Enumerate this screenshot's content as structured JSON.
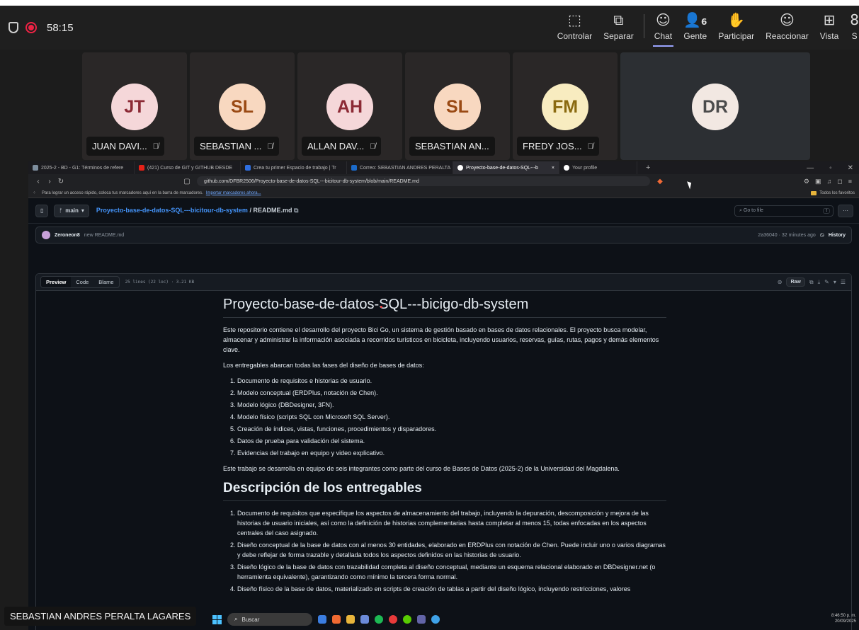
{
  "meeting": {
    "timer": "58:15",
    "tools": [
      {
        "label": "Controlar",
        "icon": "control-icon"
      },
      {
        "label": "Separar",
        "icon": "popout-icon"
      },
      {
        "label": "Chat",
        "icon": "chat-icon"
      },
      {
        "label": "Gente",
        "icon": "people-icon",
        "count": "6"
      },
      {
        "label": "Participar",
        "icon": "raise-hand-icon"
      },
      {
        "label": "Reaccionar",
        "icon": "react-icon"
      },
      {
        "label": "Vista",
        "icon": "view-icon"
      },
      {
        "label": "S",
        "icon": "share-icon"
      }
    ],
    "participants": [
      {
        "initials": "JT",
        "name": "JUAN DAVI...",
        "bg": "#f5d7d9",
        "fg": "#8c2a35"
      },
      {
        "initials": "SL",
        "name": "SEBASTIAN ...",
        "bg": "#f8d8c0",
        "fg": "#9a4a14"
      },
      {
        "initials": "AH",
        "name": "ALLAN DAV...",
        "bg": "#f5d7d9",
        "fg": "#8c2a35"
      },
      {
        "initials": "SL",
        "name": "SEBASTIAN AN...",
        "bg": "#f8d8c0",
        "fg": "#9a4a14"
      },
      {
        "initials": "FM",
        "name": "FREDY JOS...",
        "bg": "#f8ecc0",
        "fg": "#8a6a10"
      },
      {
        "initials": "DR",
        "name": "",
        "bg": "#f2e8e2",
        "fg": "#4b4b4b"
      }
    ],
    "presenter": "SEBASTIAN ANDRES PERALTA LAGARES"
  },
  "browser": {
    "tabs": [
      {
        "label": "2025-2 - BD - G1: Términos de refere",
        "color": "#7e8e9e"
      },
      {
        "label": "(421) Curso de GIT y GITHUB DESDE",
        "color": "#e62117"
      },
      {
        "label": "Crea tu primer Espacio de trabajo | Tr",
        "color": "#2f6fe0"
      },
      {
        "label": "Correo: SEBASTIAN ANDRES PERALTA",
        "color": "#1b6ac9"
      },
      {
        "label": "Proyecto-base-de-datos-SQL---b",
        "color": "#ffffff"
      },
      {
        "label": "Your profile",
        "color": "#ffffff"
      }
    ],
    "url": "github.com/DFBR2506/Proyecto-base-de-datos-SQL---bicitour-db-system/blob/main/README.md",
    "bookmarks_text": "Para lograr un acceso rápido, coloca tus marcadores aquí en la barra de marcadores.",
    "bookmarks_link": "Importar marcadores ahora...",
    "all_bookmarks": "Todos los favoritos"
  },
  "github": {
    "branch": "main",
    "repo": "Proyecto-base-de-datos-SQL---bicitour-db-system",
    "file": "README.md",
    "goto_placeholder": "Go to file",
    "goto_key": "t",
    "commit_author": "Zeroneon8",
    "commit_msg": "new README.md",
    "commit_meta": "2a36040 · 32 minutes ago",
    "history": "History",
    "view_tabs": [
      "Preview",
      "Code",
      "Blame"
    ],
    "lines_info": "25 lines (22 loc) · 3.21 KB",
    "raw": "Raw"
  },
  "readme": {
    "title": "Proyecto-base-de-datos-SQL---bicigo-db-system",
    "intro": "Este repositorio contiene el desarrollo del proyecto Bici Go, un sistema de gestión basado en bases de datos relacionales. El proyecto busca modelar, almacenar y administrar la información asociada a recorridos turísticos en bicicleta, incluyendo usuarios, reservas, guías, rutas, pagos y demás elementos clave.",
    "deliverables_intro": "Los entregables abarcan todas las fases del diseño de bases de datos:",
    "list1": [
      "Documento de requisitos e historias de usuario.",
      "Modelo conceptual (ERDPlus, notación de Chen).",
      "Modelo lógico (DBDesigner, 3FN).",
      "Modelo físico (scripts SQL con Microsoft SQL Server).",
      "Creación de índices, vistas, funciones, procedimientos y disparadores.",
      "Datos de prueba para validación del sistema.",
      "Evidencias del trabajo en equipo y video explicativo."
    ],
    "team_note": "Este trabajo se desarrolla en equipo de seis integrantes como parte del curso de Bases de Datos (2025-2) de la Universidad del Magdalena.",
    "h2": "Descripción de los entregables",
    "list2": [
      "Documento de requisitos que especifique los aspectos de almacenamiento del trabajo, incluyendo la depuración, descomposición y mejora de las historias de usuario iniciales, así como la definición de historias complementarias hasta completar al menos 15, todas enfocadas en los aspectos centrales del caso asignado.",
      "Diseño conceptual de la base de datos con al menos 30 entidades, elaborado en ERDPlus con notación de Chen. Puede incluir uno o varios diagramas y debe reflejar de forma trazable y detallada todos los aspectos definidos en las historias de usuario.",
      "Diseño lógico de la base de datos con trazabilidad completa al diseño conceptual, mediante un esquema relacional elaborado en DBDesigner.net (o herramienta equivalente), garantizando como mínimo la tercera forma normal.",
      "Diseño físico de la base de datos, materializado en scripts de creación de tablas a partir del diseño lógico, incluyendo restricciones, valores"
    ]
  },
  "taskbar": {
    "search": "Buscar",
    "time": "8:46:50 p. m.",
    "date": "20/09/2025"
  }
}
